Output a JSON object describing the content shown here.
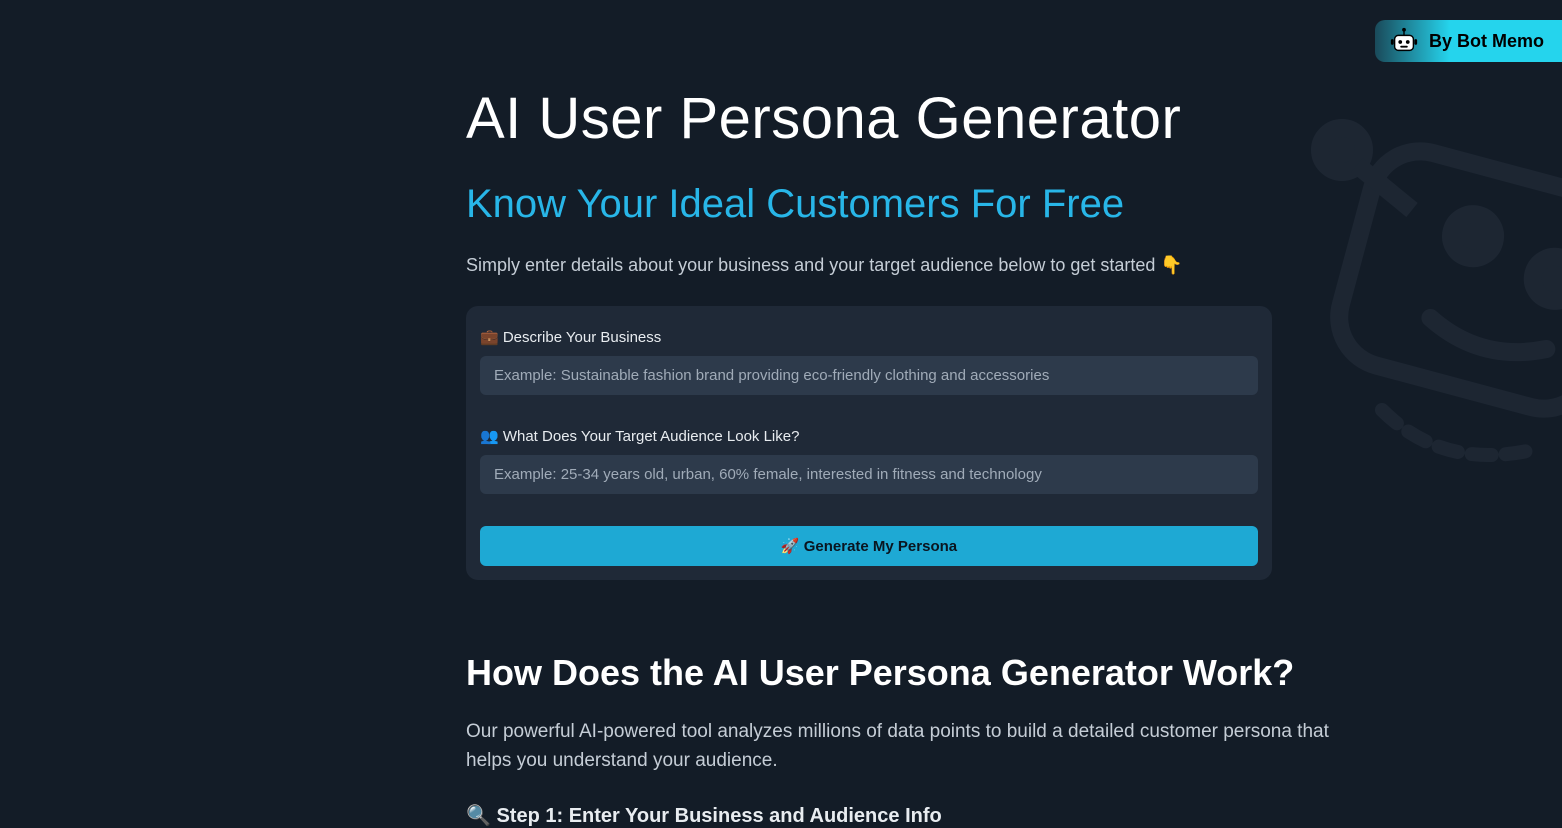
{
  "badge": {
    "text": "By Bot Memo"
  },
  "header": {
    "title": "AI User Persona Generator",
    "subtitle": "Know Your Ideal Customers For Free",
    "intro": "Simply enter details about your business and your target audience below to get started 👇"
  },
  "form": {
    "business": {
      "label": "💼 Describe Your Business",
      "placeholder": "Example: Sustainable fashion brand providing eco-friendly clothing and accessories"
    },
    "audience": {
      "label": "👥 What Does Your Target Audience Look Like?",
      "placeholder": "Example: 25-34 years old, urban, 60% female, interested in fitness and technology"
    },
    "button": "🚀 Generate My Persona"
  },
  "howItWorks": {
    "heading": "How Does the AI User Persona Generator Work?",
    "description": "Our powerful AI-powered tool analyzes millions of data points to build a detailed customer persona that helps you understand your audience.",
    "step1": "🔍 Step 1: Enter Your Business and Audience Info"
  }
}
